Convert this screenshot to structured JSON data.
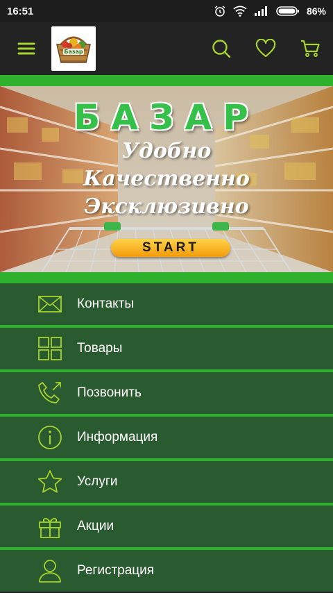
{
  "status": {
    "time": "16:51",
    "battery": "86%",
    "icons": [
      "alarm-icon",
      "wifi-icon",
      "signal-icon",
      "battery-icon"
    ]
  },
  "appbar": {
    "logo_text": "Базар",
    "actions": [
      "search-icon",
      "heart-icon",
      "cart-icon"
    ],
    "accent_color": "#a6d22e"
  },
  "banner": {
    "title": "БАЗАР",
    "lines": [
      "Удобно",
      "Качественно",
      "Эксклюзивно"
    ],
    "start_label": "START"
  },
  "menu": {
    "items": [
      {
        "label": "Контакты",
        "icon": "mail-icon"
      },
      {
        "label": "Товары",
        "icon": "grid-icon"
      },
      {
        "label": "Позвонить",
        "icon": "phone-icon"
      },
      {
        "label": "Информация",
        "icon": "info-icon"
      },
      {
        "label": "Услуги",
        "icon": "star-icon"
      },
      {
        "label": "Акции",
        "icon": "gift-icon"
      },
      {
        "label": "Регистрация",
        "icon": "user-icon"
      }
    ],
    "background_color": "#2a5a30",
    "divider_color": "#2fb12e"
  }
}
